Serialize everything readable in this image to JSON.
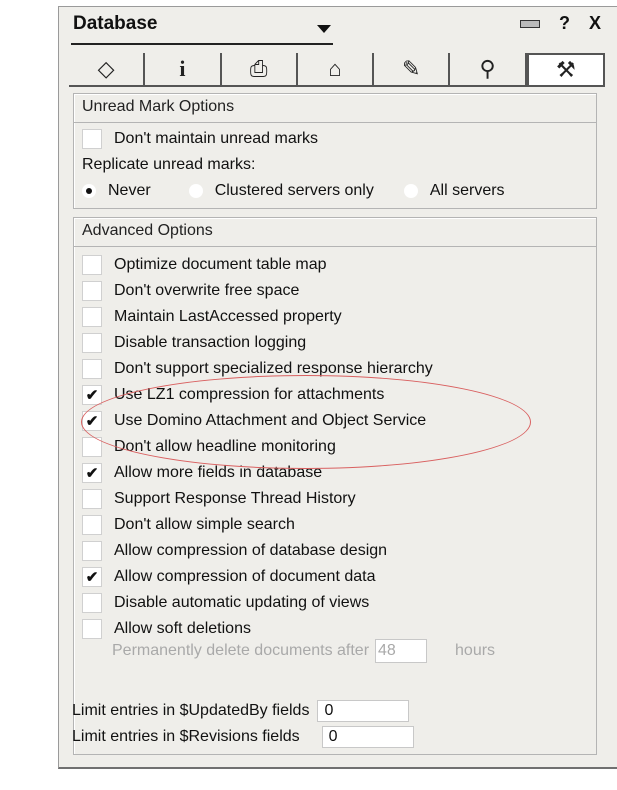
{
  "window": {
    "title": "Database",
    "controls": [
      "?",
      "X"
    ]
  },
  "tabs": [
    {
      "name": "basics-tab-icon",
      "glyph": "◇"
    },
    {
      "name": "info-tab-icon",
      "glyph": "i"
    },
    {
      "name": "print-tab-icon",
      "glyph": "⎙"
    },
    {
      "name": "design-tab-icon",
      "glyph": "⌂"
    },
    {
      "name": "launch-tab-icon",
      "glyph": "✎"
    },
    {
      "name": "search-tab-icon",
      "glyph": "⚲"
    },
    {
      "name": "advanced-tab-icon",
      "glyph": "⚒"
    }
  ],
  "unread": {
    "header": "Unread Mark Options",
    "dont_maintain": {
      "label": "Don't maintain unread marks",
      "checked": false
    },
    "replicate_label": "Replicate unread marks:",
    "radios": [
      {
        "label": "Never",
        "selected": true
      },
      {
        "label": "Clustered servers only",
        "selected": false
      },
      {
        "label": "All servers",
        "selected": false
      }
    ]
  },
  "advanced": {
    "header": "Advanced Options",
    "options": [
      {
        "label": "Optimize document table map",
        "checked": false
      },
      {
        "label": "Don't overwrite free space",
        "checked": false
      },
      {
        "label": "Maintain LastAccessed property",
        "checked": false
      },
      {
        "label": "Disable transaction logging",
        "checked": false
      },
      {
        "label": "Don't support specialized response hierarchy",
        "checked": false
      },
      {
        "label": "Use LZ1 compression for attachments",
        "checked": true
      },
      {
        "label": "Use Domino Attachment and Object Service",
        "checked": true
      },
      {
        "label": "Don't allow headline monitoring",
        "checked": false
      },
      {
        "label": "Allow more fields in database",
        "checked": true
      },
      {
        "label": "Support Response Thread History",
        "checked": false
      },
      {
        "label": "Don't allow simple search",
        "checked": false
      },
      {
        "label": "Allow compression of database design",
        "checked": false
      },
      {
        "label": "Allow compression of document data",
        "checked": true
      },
      {
        "label": "Disable automatic updating of views",
        "checked": false
      },
      {
        "label": "Allow soft deletions",
        "checked": false
      }
    ],
    "soft_delete": {
      "prefix": "Permanently delete documents after",
      "value": "48",
      "suffix": "hours"
    },
    "limit_updatedby": {
      "label": "Limit entries in $UpdatedBy fields",
      "value": "0"
    },
    "limit_revisions": {
      "label": "Limit entries in $Revisions fields",
      "value": "0"
    }
  },
  "colors": {
    "annotation_ellipse": "#d96060",
    "panel_bg": "#efeeea"
  }
}
